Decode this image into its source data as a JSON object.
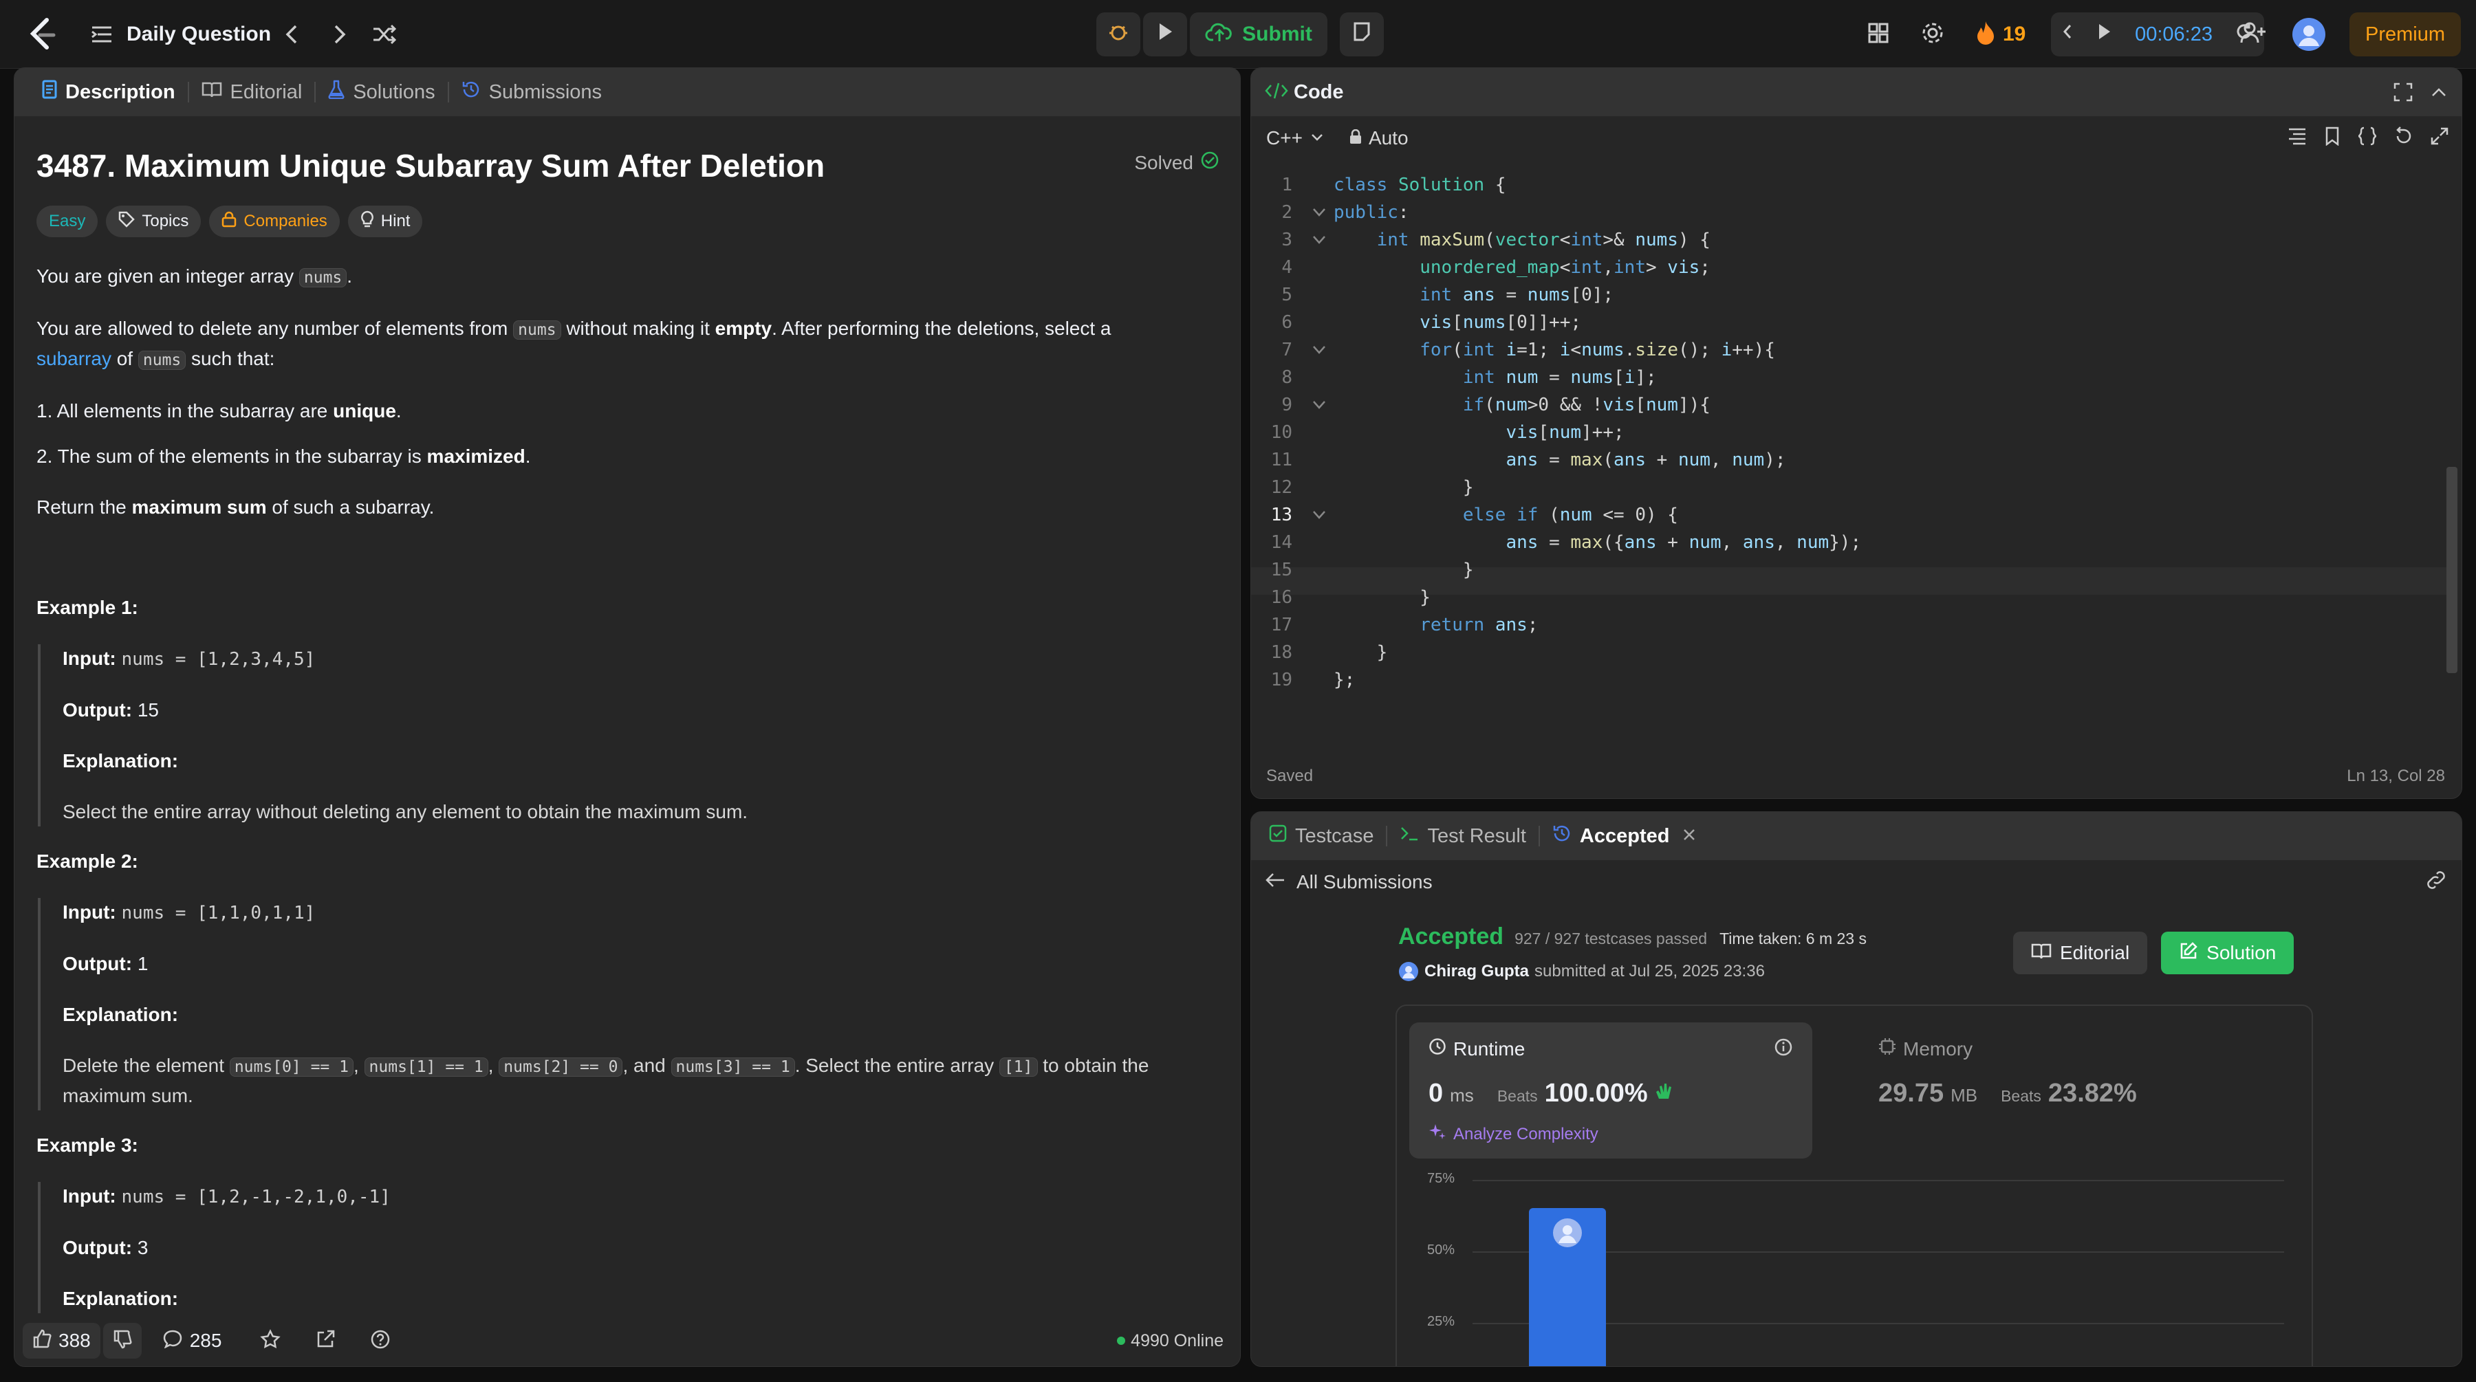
{
  "topbar": {
    "title": "Daily Question",
    "submit_label": "Submit",
    "streak": "19",
    "timer": "00:06:23",
    "premium_label": "Premium"
  },
  "left_tabs": [
    "Description",
    "Editorial",
    "Solutions",
    "Submissions"
  ],
  "problem": {
    "title": "3487. Maximum Unique Subarray Sum After Deletion",
    "solved_label": "Solved",
    "tags": [
      "Easy",
      "Topics",
      "Companies",
      "Hint"
    ],
    "p1_pre": "You are given an integer array ",
    "p1_code": "nums",
    "p1_post": ".",
    "p2_a": "You are allowed to delete any number of elements from ",
    "p2_code": "nums",
    "p2_b": " without making it ",
    "p2_bold": "empty",
    "p2_c": ". After performing the deletions, select a",
    "p2_link": "subarray",
    "p2_d": " of ",
    "p2_code2": "nums",
    "p2_e": " such that:",
    "li1_pre": "1. All elements in the subarray are ",
    "li1_bold": "unique",
    "li1_post": ".",
    "li2_pre": "2. The sum of the elements in the subarray is ",
    "li2_bold": "maximized",
    "li2_post": ".",
    "ret_pre": "Return the ",
    "ret_bold": "maximum sum",
    "ret_post": " of such a subarray.",
    "ex1_title": "Example 1:",
    "ex1_input_label": "Input:",
    "ex1_input": "nums = [1,2,3,4,5]",
    "ex1_output_label": "Output:",
    "ex1_output": "15",
    "ex1_expl_label": "Explanation:",
    "ex1_expl": "Select the entire array without deleting any element to obtain the maximum sum.",
    "ex2_title": "Example 2:",
    "ex2_input_label": "Input:",
    "ex2_input": "nums = [1,1,0,1,1]",
    "ex2_output_label": "Output:",
    "ex2_output": "1",
    "ex2_expl_label": "Explanation:",
    "ex2_expl_a": "Delete the element ",
    "ex2_c1": "nums[0] == 1",
    "ex2_c2": "nums[1] == 1",
    "ex2_c3": "nums[2] == 0",
    "ex2_and": ", and ",
    "ex2_c4": "nums[3] == 1",
    "ex2_expl_b": ". Select the entire array ",
    "ex2_c5": "[1]",
    "ex2_expl_c": " to obtain the",
    "ex2_expl_d": "maximum sum.",
    "ex3_title": "Example 3:",
    "ex3_input_label": "Input:",
    "ex3_input": "nums = [1,2,-1,-2,1,0,-1]",
    "ex3_output_label": "Output:",
    "ex3_output": "3",
    "ex3_expl_label": "Explanation:"
  },
  "left_footer": {
    "likes": "388",
    "comments": "285",
    "online": "4990 Online"
  },
  "code_panel": {
    "title": "Code",
    "language": "C++",
    "mode": "Auto",
    "saved": "Saved",
    "cursor": "Ln 13, Col 28",
    "lines": [
      "class Solution {",
      "public:",
      "    int maxSum(vector<int>& nums) {",
      "        unordered_map<int,int> vis;",
      "        int ans = nums[0];",
      "        vis[nums[0]]++;",
      "        for(int i=1; i<nums.size(); i++){",
      "            int num = nums[i];",
      "            if(num>0 && !vis[num]){",
      "                vis[num]++;",
      "                ans = max(ans + num, num);",
      "            }",
      "            else if (num <= 0) {",
      "                ans = max({ans + num, ans, num});",
      "            }",
      "        }",
      "        return ans;",
      "    }",
      "};"
    ],
    "line_numbers": [
      "1",
      "2",
      "3",
      "4",
      "5",
      "6",
      "7",
      "8",
      "9",
      "10",
      "11",
      "12",
      "13",
      "14",
      "15",
      "16",
      "17",
      "18",
      "19"
    ]
  },
  "result_panel": {
    "tabs": [
      "Testcase",
      "Test Result",
      "Accepted"
    ],
    "back_label": "All Submissions",
    "status": "Accepted",
    "passed": "927 / 927 testcases passed",
    "time_taken": "Time taken: 6 m 23 s",
    "user": "Chirag Gupta",
    "submitted": "submitted at Jul 25, 2025 23:36",
    "editorial_btn": "Editorial",
    "solution_btn": "Solution",
    "runtime_label": "Runtime",
    "runtime_value": "0",
    "runtime_unit": "ms",
    "beats_label": "Beats",
    "runtime_beats": "100.00%",
    "analyze": "Analyze Complexity",
    "memory_label": "Memory",
    "memory_value": "29.75",
    "memory_unit": "MB",
    "memory_beats": "23.82%",
    "chart_ticks": [
      "75%",
      "50%",
      "25%"
    ]
  }
}
